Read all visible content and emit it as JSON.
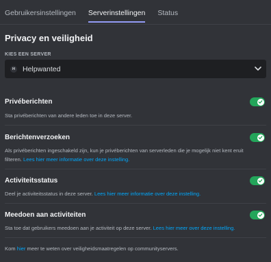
{
  "tabs": [
    {
      "label": "Gebruikersinstellingen"
    },
    {
      "label": "Serverinstellingen"
    },
    {
      "label": "Status"
    }
  ],
  "section_title": "Privacy en veiligheid",
  "server_picker": {
    "label": "KIES EEN SERVER",
    "icon_letter": "H",
    "selected": "Helpwanted"
  },
  "settings": [
    {
      "title": "Privéberichten",
      "desc": "Sta privéberichten van andere leden toe in deze server.",
      "link": "",
      "enabled": true
    },
    {
      "title": "Berichtenverzoeken",
      "desc": "Als privéberichten ingeschakeld zijn, kun je privéberichten van serverleden die je mogelijk niet kent eruit filteren.",
      "link": "Lees hier meer informatie over deze instelling.",
      "enabled": true
    },
    {
      "title": "Activiteitsstatus",
      "desc": "Deel je activiteitsstatus in deze server.",
      "link": "Lees hier meer informatie over deze instelling.",
      "enabled": true
    },
    {
      "title": "Meedoen aan activiteiten",
      "desc": "Sta toe dat gebruikers meedoen aan je activiteit op deze server.",
      "link": "Lees hier meer over deze instelling.",
      "enabled": true
    }
  ],
  "footer": {
    "before": "Kom",
    "link": "hier",
    "after": "meer te weten over veiligheidsmaatregelen op communityservers."
  },
  "colors": {
    "background": "#313338",
    "toggle_on": "#23a55a",
    "link": "#00a8fc",
    "tab_indicator": "#949cf7"
  }
}
